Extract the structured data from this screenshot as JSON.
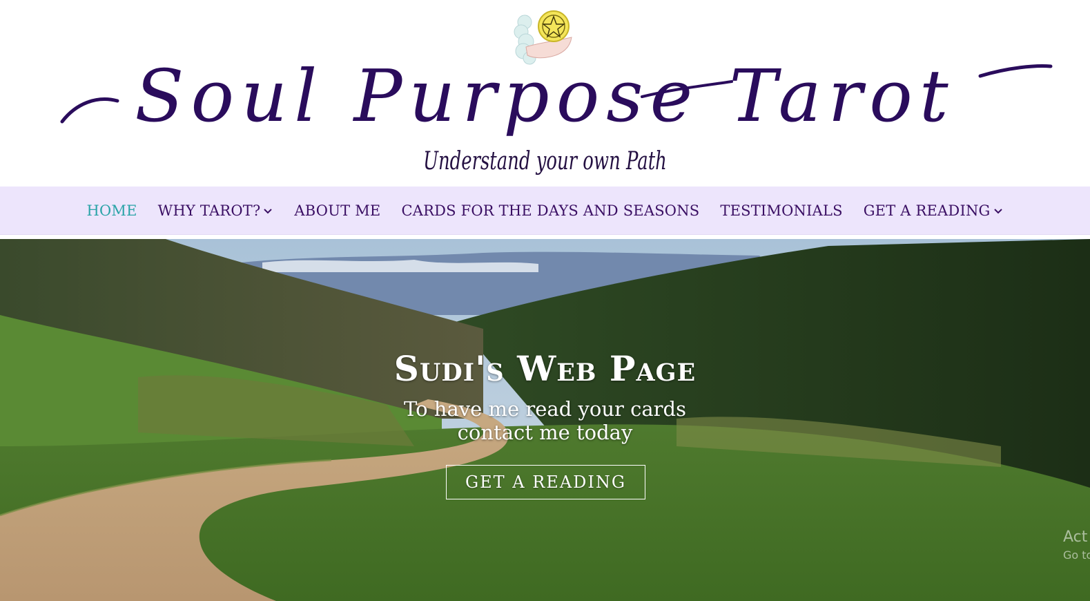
{
  "header": {
    "title": "Soul Purpose Tarot",
    "tagline": "Understand your own Path",
    "logo_icon": "pentacle-coin-in-hand-icon"
  },
  "nav": {
    "items": [
      {
        "label": "HOME",
        "active": true,
        "has_dropdown": false
      },
      {
        "label": "WHY TAROT?",
        "active": false,
        "has_dropdown": true
      },
      {
        "label": "ABOUT ME",
        "active": false,
        "has_dropdown": false
      },
      {
        "label": "CARDS FOR THE DAYS AND SEASONS",
        "active": false,
        "has_dropdown": false
      },
      {
        "label": "TESTIMONIALS",
        "active": false,
        "has_dropdown": false
      },
      {
        "label": "GET A READING",
        "active": false,
        "has_dropdown": true
      }
    ]
  },
  "hero": {
    "heading": "Sudi's Web Page",
    "sub_line1": "To have me read your cards",
    "sub_line2": "contact me today",
    "cta_label": "GET A READING"
  },
  "os_watermark": {
    "title": "Act",
    "subtitle": "Go to"
  },
  "colors": {
    "title": "#2a0c5c",
    "nav_bg": "#ede5fc",
    "nav_text": "#3a0f63",
    "nav_active": "#2aa4a8"
  }
}
